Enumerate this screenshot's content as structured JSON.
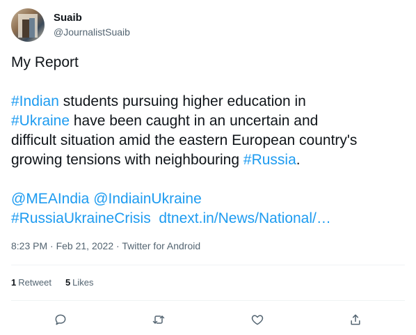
{
  "author": {
    "name": "Suaib",
    "handle": "@JournalistSuaib"
  },
  "tweet": {
    "line1": "My Report",
    "seg_indian": "#Indian",
    "seg_a": " students pursuing higher education in\n",
    "seg_ukraine": "#Ukraine",
    "seg_b": " have been caught in an uncertain and\ndifficult situation amid the eastern European country's\ngrowing tensions with neighbouring ",
    "seg_russia": "#Russia",
    "seg_c": ".",
    "mention1": "@MEAIndia",
    "mention2": "@IndiainUkraine",
    "hashtag_crisis": "#RussiaUkraineCrisis",
    "link": "dtnext.in/News/National/…"
  },
  "meta": {
    "time": "8:23 PM",
    "date": "Feb 21, 2022",
    "source": "Twitter for Android"
  },
  "stats": {
    "retweets_count": "1",
    "retweets_label": "Retweet",
    "likes_count": "5",
    "likes_label": "Likes"
  },
  "colors": {
    "link": "#1d9bf0",
    "text": "#0f1419",
    "secondary": "#536471"
  },
  "icons": [
    "reply-icon",
    "retweet-icon",
    "like-icon",
    "share-icon"
  ]
}
